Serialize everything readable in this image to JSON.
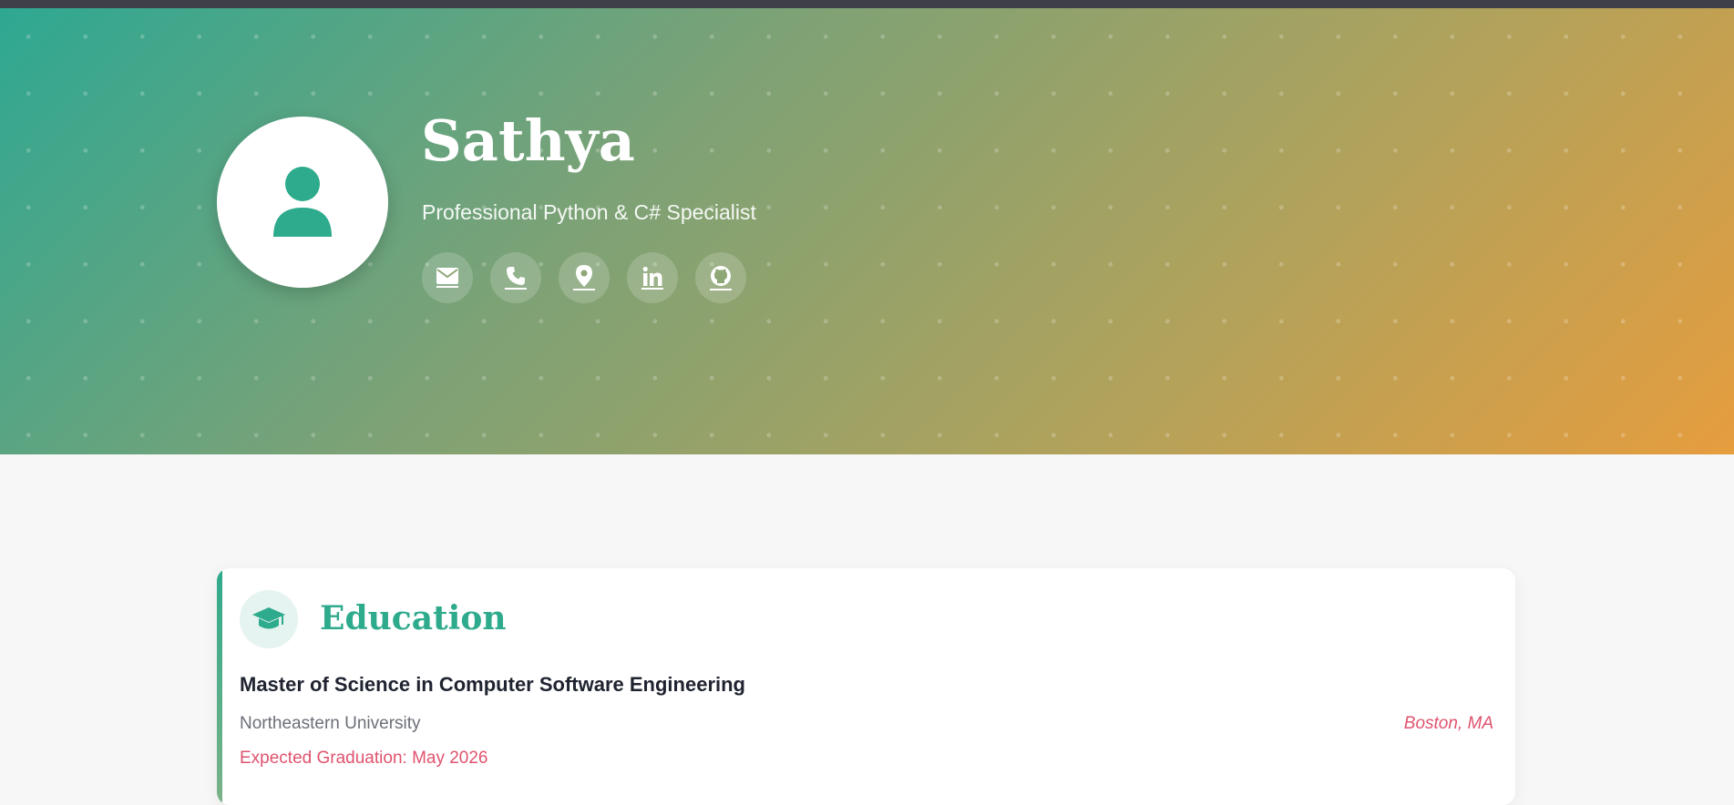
{
  "header": {
    "name": "Sathya",
    "tagline": "Professional Python & C# Specialist",
    "avatar_icon": "user-icon",
    "contacts": [
      {
        "icon": "envelope-icon",
        "label": "Email"
      },
      {
        "icon": "phone-icon",
        "label": "Phone"
      },
      {
        "icon": "map-pin-icon",
        "label": "Location"
      },
      {
        "icon": "linkedin-icon",
        "label": "LinkedIn"
      },
      {
        "icon": "github-icon",
        "label": "GitHub"
      }
    ]
  },
  "education": {
    "icon": "graduation-cap-icon",
    "title": "Education",
    "degree": "Master of Science in Computer Software Engineering",
    "school": "Northeastern University",
    "location": "Boston, MA",
    "graduation": "Expected Graduation: May 2026"
  },
  "colors": {
    "accent": "#2eaa8c",
    "highlight": "#e0536e",
    "gradient_start": "#2ea892",
    "gradient_end": "#e69d3e"
  }
}
